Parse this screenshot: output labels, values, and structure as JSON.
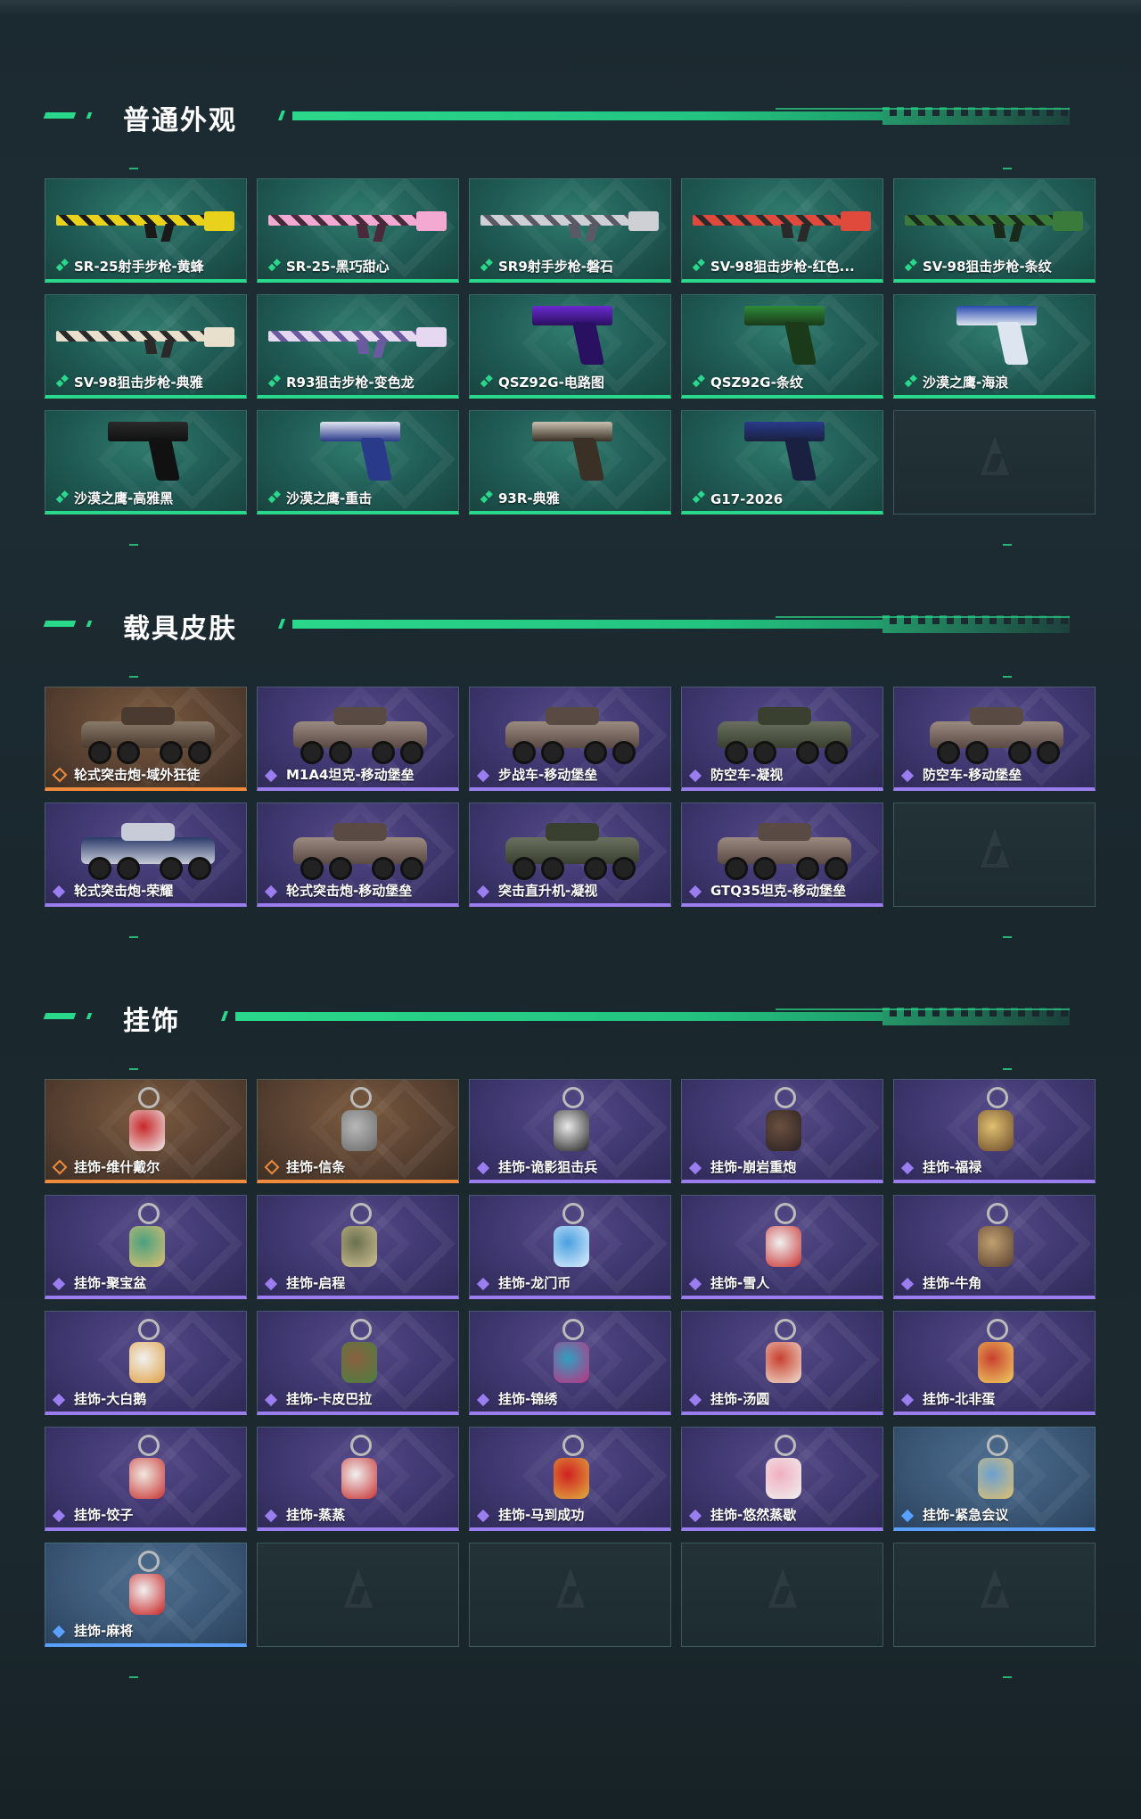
{
  "sections": [
    {
      "title": "普通外观",
      "items": [
        {
          "label": "SR-25射手步枪-黄蜂",
          "rarity": "green",
          "kind": "rifle",
          "colors": [
            "#e8d21c",
            "#1a1a1a"
          ]
        },
        {
          "label": "SR-25-黑巧甜心",
          "rarity": "green",
          "kind": "rifle",
          "colors": [
            "#f3a9d2",
            "#4a2a3a"
          ]
        },
        {
          "label": "SR9射手步枪-磐石",
          "rarity": "green",
          "kind": "rifle",
          "colors": [
            "#cfcfd6",
            "#5a5a66"
          ]
        },
        {
          "label": "SV-98狙击步枪-红色...",
          "rarity": "green",
          "kind": "rifle",
          "colors": [
            "#e04a3c",
            "#2a2a2a"
          ]
        },
        {
          "label": "SV-98狙击步枪-条纹",
          "rarity": "green",
          "kind": "rifle",
          "colors": [
            "#3a7a3a",
            "#1a2a1a"
          ]
        },
        {
          "label": "SV-98狙击步枪-典雅",
          "rarity": "green",
          "kind": "rifle",
          "colors": [
            "#e8e0cc",
            "#2a2a2a"
          ]
        },
        {
          "label": "R93狙击步枪-变色龙",
          "rarity": "green",
          "kind": "rifle",
          "colors": [
            "#e6d8f0",
            "#6a5aa0"
          ]
        },
        {
          "label": "QSZ92G-电路图",
          "rarity": "green",
          "kind": "pistol",
          "colors": [
            "#6a2ad0",
            "#2a1060"
          ]
        },
        {
          "label": "QSZ92G-条纹",
          "rarity": "green",
          "kind": "pistol",
          "colors": [
            "#2e8a3a",
            "#1a3a1a"
          ]
        },
        {
          "label": "沙漠之鹰-海浪",
          "rarity": "green",
          "kind": "pistol",
          "colors": [
            "#2a4ab0",
            "#dde6f0"
          ]
        },
        {
          "label": "沙漠之鹰-高雅黑",
          "rarity": "green",
          "kind": "pistol",
          "colors": [
            "#2a2a2a",
            "#111111"
          ]
        },
        {
          "label": "沙漠之鹰-重击",
          "rarity": "green",
          "kind": "pistol",
          "colors": [
            "#e0e4f0",
            "#2a3a8a"
          ]
        },
        {
          "label": "93R-典雅",
          "rarity": "green",
          "kind": "pistol",
          "colors": [
            "#c8c0b0",
            "#3a3026"
          ]
        },
        {
          "label": "G17-2026",
          "rarity": "green",
          "kind": "pistol",
          "colors": [
            "#2a3a8a",
            "#1a2040"
          ]
        },
        {
          "label": "",
          "rarity": "empty",
          "kind": "empty",
          "colors": []
        }
      ]
    },
    {
      "title": "载具皮肤",
      "items": [
        {
          "label": "轮式突击炮-域外狂徒",
          "rarity": "orange",
          "kind": "vehicle",
          "colors": [
            "#4a3a30",
            "#8a7a6a"
          ]
        },
        {
          "label": "M1A4坦克-移动堡垒",
          "rarity": "purple",
          "kind": "vehicle",
          "colors": [
            "#5a4a44",
            "#9a8a80"
          ]
        },
        {
          "label": "步战车-移动堡垒",
          "rarity": "purple",
          "kind": "vehicle",
          "colors": [
            "#5a4a44",
            "#9a8a80"
          ]
        },
        {
          "label": "防空车-凝视",
          "rarity": "purple",
          "kind": "vehicle",
          "colors": [
            "#3a4030",
            "#6a7060"
          ]
        },
        {
          "label": "防空车-移动堡垒",
          "rarity": "purple",
          "kind": "vehicle",
          "colors": [
            "#5a4a44",
            "#9a8a80"
          ]
        },
        {
          "label": "轮式突击炮-荣耀",
          "rarity": "purple",
          "kind": "vehicle",
          "colors": [
            "#c8ccd8",
            "#2a3a6a"
          ]
        },
        {
          "label": "轮式突击炮-移动堡垒",
          "rarity": "purple",
          "kind": "vehicle",
          "colors": [
            "#5a4a44",
            "#9a8a80"
          ]
        },
        {
          "label": "突击直升机-凝视",
          "rarity": "purple",
          "kind": "vehicle",
          "colors": [
            "#3a4030",
            "#6a7060"
          ]
        },
        {
          "label": "GTQ35坦克-移动堡垒",
          "rarity": "purple",
          "kind": "vehicle",
          "colors": [
            "#5a4a44",
            "#9a8a80"
          ]
        },
        {
          "label": "",
          "rarity": "empty",
          "kind": "empty",
          "colors": []
        }
      ]
    },
    {
      "title": "挂饰",
      "items": [
        {
          "label": "挂饰-维什戴尔",
          "rarity": "orange",
          "kind": "charm",
          "colors": [
            "#c8282a",
            "#eeeeee"
          ]
        },
        {
          "label": "挂饰-信条",
          "rarity": "orange",
          "kind": "charm",
          "colors": [
            "#b8b8b8",
            "#6a6a6a"
          ]
        },
        {
          "label": "挂饰-诡影狙击兵",
          "rarity": "purple",
          "kind": "charm",
          "colors": [
            "#e8e8e8",
            "#222222"
          ]
        },
        {
          "label": "挂饰-崩岩重炮",
          "rarity": "purple",
          "kind": "charm",
          "colors": [
            "#6a5040",
            "#2a2020"
          ]
        },
        {
          "label": "挂饰-福禄",
          "rarity": "purple",
          "kind": "charm",
          "colors": [
            "#e0c070",
            "#6a4a2a"
          ]
        },
        {
          "label": "挂饰-聚宝盆",
          "rarity": "purple",
          "kind": "charm",
          "colors": [
            "#4aa080",
            "#e0c070"
          ]
        },
        {
          "label": "挂饰-启程",
          "rarity": "purple",
          "kind": "charm",
          "colors": [
            "#6a7050",
            "#d0c090"
          ]
        },
        {
          "label": "挂饰-龙门币",
          "rarity": "purple",
          "kind": "charm",
          "colors": [
            "#4aa0e0",
            "#e0f0ff"
          ]
        },
        {
          "label": "挂饰-雪人",
          "rarity": "purple",
          "kind": "charm",
          "colors": [
            "#f0f0f0",
            "#c83030"
          ]
        },
        {
          "label": "挂饰-牛角",
          "rarity": "purple",
          "kind": "charm",
          "colors": [
            "#c0a070",
            "#5a4030"
          ]
        },
        {
          "label": "挂饰-大白鹅",
          "rarity": "purple",
          "kind": "charm",
          "colors": [
            "#f0f0f0",
            "#e0a040"
          ]
        },
        {
          "label": "挂饰-卡皮巴拉",
          "rarity": "purple",
          "kind": "charm",
          "colors": [
            "#8a6040",
            "#4a8040"
          ]
        },
        {
          "label": "挂饰-锦绣",
          "rarity": "purple",
          "kind": "charm",
          "colors": [
            "#30a0c0",
            "#c03080"
          ]
        },
        {
          "label": "挂饰-汤圆",
          "rarity": "purple",
          "kind": "charm",
          "colors": [
            "#c84030",
            "#f0e0d0"
          ]
        },
        {
          "label": "挂饰-北非蛋",
          "rarity": "purple",
          "kind": "charm",
          "colors": [
            "#c84030",
            "#f0d060"
          ]
        },
        {
          "label": "挂饰-饺子",
          "rarity": "purple",
          "kind": "charm",
          "colors": [
            "#f0e8e0",
            "#c83030"
          ]
        },
        {
          "label": "挂饰-蒸蒸",
          "rarity": "purple",
          "kind": "charm",
          "colors": [
            "#f0f0f0",
            "#c83030"
          ]
        },
        {
          "label": "挂饰-马到成功",
          "rarity": "purple",
          "kind": "charm",
          "colors": [
            "#d02020",
            "#e0b040"
          ]
        },
        {
          "label": "挂饰-悠然蒸歇",
          "rarity": "purple",
          "kind": "charm",
          "colors": [
            "#f0b0c0",
            "#f0f0f0"
          ]
        },
        {
          "label": "挂饰-紧急会议",
          "rarity": "blue",
          "kind": "charm",
          "colors": [
            "#6aa0d0",
            "#e0c070"
          ]
        },
        {
          "label": "挂饰-麻将",
          "rarity": "blue",
          "kind": "charm",
          "colors": [
            "#f0f0f0",
            "#c82020"
          ]
        },
        {
          "label": "",
          "rarity": "empty",
          "kind": "empty",
          "colors": []
        },
        {
          "label": "",
          "rarity": "empty",
          "kind": "empty",
          "colors": []
        },
        {
          "label": "",
          "rarity": "empty",
          "kind": "empty",
          "colors": []
        },
        {
          "label": "",
          "rarity": "empty",
          "kind": "empty",
          "colors": []
        }
      ]
    }
  ],
  "colors": {
    "accent": "#2ad88b",
    "purple": "#9a7ef0",
    "orange": "#f08a3c",
    "blue": "#5aa0ff"
  }
}
